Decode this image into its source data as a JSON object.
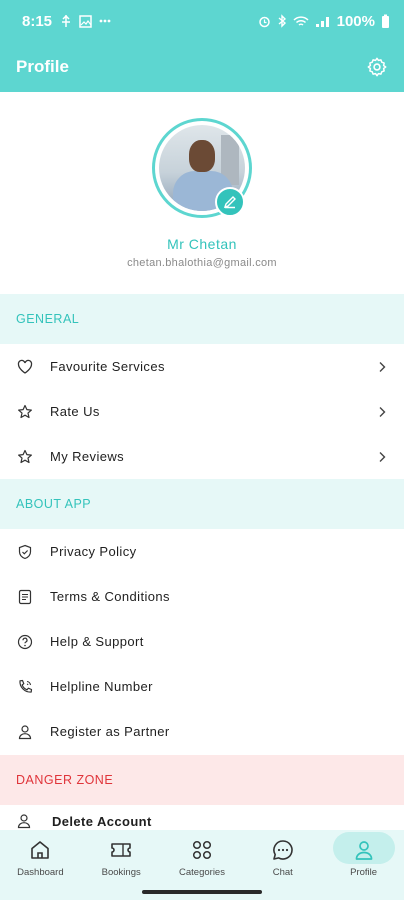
{
  "status_bar": {
    "time": "8:15",
    "battery": "100%"
  },
  "app_bar": {
    "title": "Profile"
  },
  "profile": {
    "name": "Mr Chetan",
    "email": "chetan.bhalothia@gmail.com"
  },
  "sections": {
    "general": {
      "title": "GENERAL",
      "items": [
        {
          "label": "Favourite Services",
          "icon": "heart-icon"
        },
        {
          "label": "Rate Us",
          "icon": "star-icon"
        },
        {
          "label": "My Reviews",
          "icon": "star-icon"
        }
      ]
    },
    "about": {
      "title": "ABOUT APP",
      "items": [
        {
          "label": "Privacy Policy",
          "icon": "shield-check-icon"
        },
        {
          "label": "Terms & Conditions",
          "icon": "document-icon"
        },
        {
          "label": "Help & Support",
          "icon": "help-circle-icon"
        },
        {
          "label": "Helpline Number",
          "icon": "phone-icon"
        },
        {
          "label": "Register as Partner",
          "icon": "user-icon"
        }
      ]
    },
    "danger": {
      "title": "DANGER ZONE",
      "items": [
        {
          "label": "Delete Account",
          "icon": "user-icon"
        }
      ]
    }
  },
  "bottom_nav": [
    {
      "label": "Dashboard",
      "icon": "home-icon"
    },
    {
      "label": "Bookings",
      "icon": "ticket-icon"
    },
    {
      "label": "Categories",
      "icon": "grid-icon"
    },
    {
      "label": "Chat",
      "icon": "chat-icon"
    },
    {
      "label": "Profile",
      "icon": "user-icon",
      "active": true
    }
  ],
  "colors": {
    "primary": "#5dd6d0",
    "accent": "#33c3bb",
    "section_bg": "#e6f8f7",
    "danger": "#e0343a",
    "danger_bg": "#fde8e8"
  }
}
